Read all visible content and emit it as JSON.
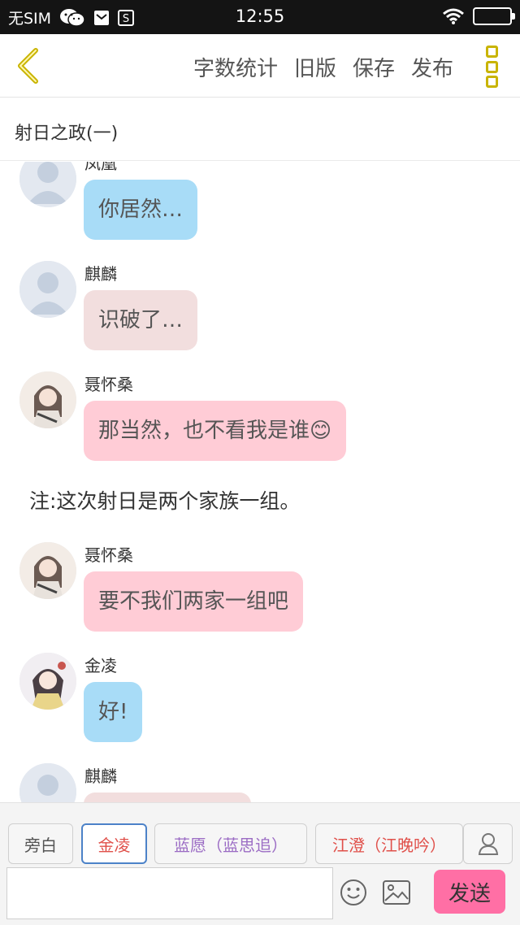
{
  "status_bar": {
    "carrier": "无SIM",
    "time": "12:55",
    "icons": [
      "wechat-icon",
      "mail-icon",
      "s-app-icon",
      "wifi-icon",
      "battery-icon"
    ]
  },
  "toolbar": {
    "back_icon": "chevron-left-icon",
    "actions": [
      "字数统计",
      "旧版",
      "保存",
      "发布"
    ],
    "more_icon": "more-vertical-icon",
    "accent_color": "#c9b400"
  },
  "chapter": {
    "title": "射日之政(一)"
  },
  "messages": [
    {
      "speaker": "凤凰",
      "text": "你居然…",
      "bubble_color": "#a8dcf7",
      "avatar": "default-avatar-icon"
    },
    {
      "speaker": "麒麟",
      "text": "识破了…",
      "bubble_color": "#f2dede",
      "avatar": "default-avatar-icon"
    },
    {
      "speaker": "聂怀桑",
      "text": "那当然，也不看我是谁😊",
      "bubble_color": "#ffccd6",
      "avatar": "anime-character-avatar"
    },
    {
      "narration": "注:这次射日是两个家族一组。"
    },
    {
      "speaker": "聂怀桑",
      "text": "要不我们两家一组吧",
      "bubble_color": "#ffccd6",
      "avatar": "anime-character-avatar"
    },
    {
      "speaker": "金凌",
      "text": "好!",
      "bubble_color": "#a8dcf7",
      "avatar": "anime-character-avatar"
    },
    {
      "speaker": "麒麟",
      "text": "",
      "bubble_color": "#f2dede",
      "avatar": "default-avatar-icon"
    }
  ],
  "roles": [
    {
      "label": "旁白",
      "color": "#555555",
      "selected": false
    },
    {
      "label": "金凌",
      "color": "#e0504a",
      "selected": true
    },
    {
      "label": "蓝愿（蓝思追）",
      "color": "#9b6cc4",
      "selected": false
    },
    {
      "label": "江澄（江晚吟）",
      "color": "#e0504a",
      "selected": false
    }
  ],
  "input": {
    "value": "",
    "placeholder": "",
    "send_label": "发送",
    "send_color": "#ff6fa5"
  }
}
